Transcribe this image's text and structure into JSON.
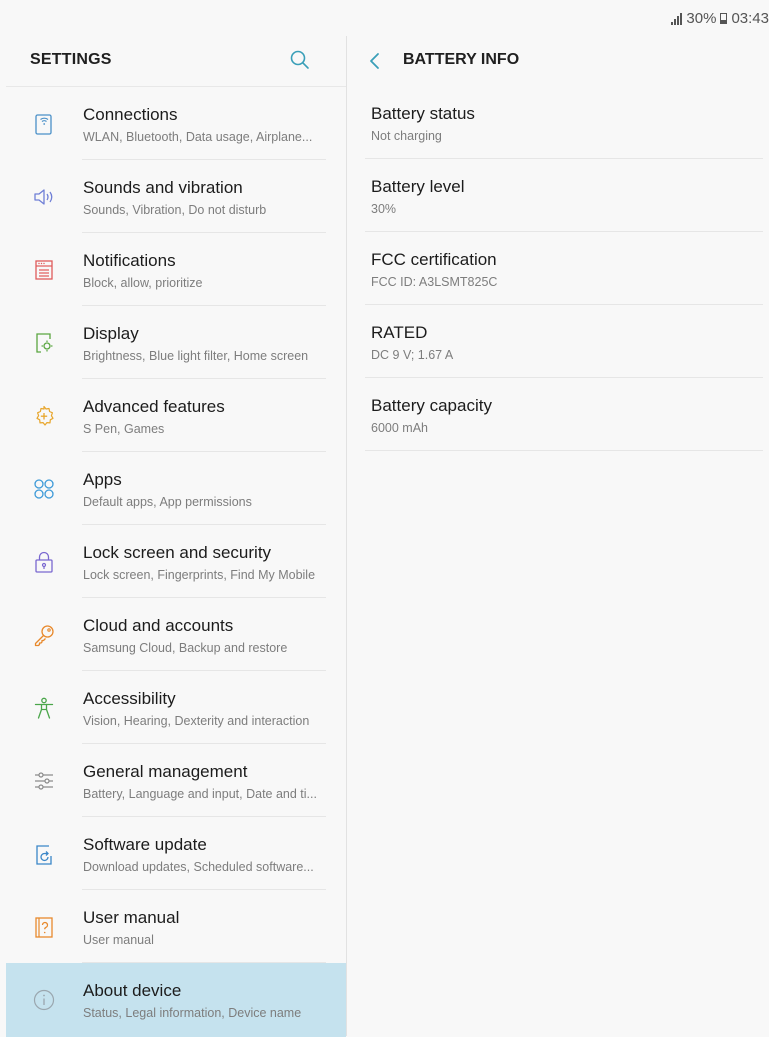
{
  "status": {
    "battery_percent": "30%",
    "time": "03:43"
  },
  "settings": {
    "title": "SETTINGS",
    "search_icon": "search-icon",
    "items": [
      {
        "title": "Connections",
        "subtitle": "WLAN, Bluetooth, Data usage, Airplane...",
        "icon": "connections-icon",
        "color": "#4a90c8"
      },
      {
        "title": "Sounds and vibration",
        "subtitle": "Sounds, Vibration, Do not disturb",
        "icon": "speaker-icon",
        "color": "#6f7fd6"
      },
      {
        "title": "Notifications",
        "subtitle": "Block, allow, prioritize",
        "icon": "notifications-icon",
        "color": "#e05a5a"
      },
      {
        "title": "Display",
        "subtitle": "Brightness, Blue light filter, Home screen",
        "icon": "display-icon",
        "color": "#5aa640"
      },
      {
        "title": "Advanced features",
        "subtitle": "S Pen, Games",
        "icon": "advanced-features-icon",
        "color": "#e8a62c"
      },
      {
        "title": "Apps",
        "subtitle": "Default apps, App permissions",
        "icon": "apps-icon",
        "color": "#3d9ad8"
      },
      {
        "title": "Lock screen and security",
        "subtitle": "Lock screen, Fingerprints, Find My Mobile",
        "icon": "lock-icon",
        "color": "#7a68d0"
      },
      {
        "title": "Cloud and accounts",
        "subtitle": "Samsung Cloud, Backup and restore",
        "icon": "key-icon",
        "color": "#e8892c"
      },
      {
        "title": "Accessibility",
        "subtitle": "Vision, Hearing, Dexterity and interaction",
        "icon": "accessibility-icon",
        "color": "#4aa64a"
      },
      {
        "title": "General management",
        "subtitle": "Battery, Language and input, Date and ti...",
        "icon": "sliders-icon",
        "color": "#8a8a8a"
      },
      {
        "title": "Software update",
        "subtitle": "Download updates, Scheduled software...",
        "icon": "software-update-icon",
        "color": "#3a86c8"
      },
      {
        "title": "User manual",
        "subtitle": "User manual",
        "icon": "user-manual-icon",
        "color": "#e8892c"
      },
      {
        "title": "About device",
        "subtitle": "Status, Legal information, Device name",
        "icon": "info-icon",
        "color": "#9aa6ae",
        "selected": true
      }
    ]
  },
  "battery_info": {
    "title": "BATTERY INFO",
    "back_icon": "back-arrow-icon",
    "accent": "#3a9fb8",
    "items": [
      {
        "title": "Battery status",
        "value": "Not charging"
      },
      {
        "title": "Battery level",
        "value": "30%"
      },
      {
        "title": "FCC certification",
        "value": "FCC ID: A3LSMT825C"
      },
      {
        "title": "RATED",
        "value": "DC 9 V; 1.67 A"
      },
      {
        "title": "Battery capacity",
        "value": "6000 mAh"
      }
    ]
  }
}
